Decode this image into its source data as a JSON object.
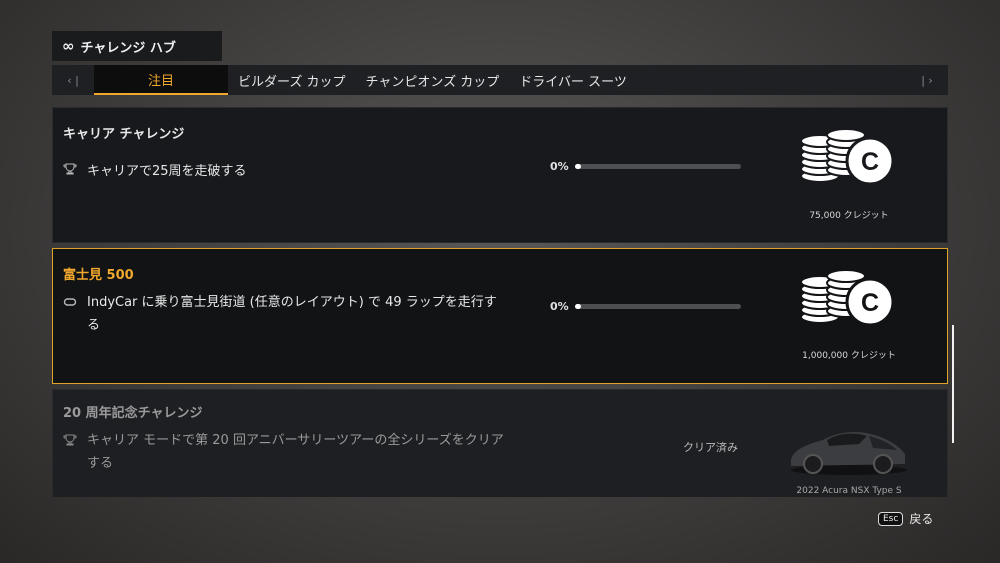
{
  "header": {
    "title_icon": "infinity-icon",
    "title": "チャレンジ ハブ"
  },
  "tabs": {
    "prev_label": "‹ |",
    "next_label": "| ›",
    "items": [
      {
        "label": "注目",
        "active": true
      },
      {
        "label": "ビルダーズ カップ"
      },
      {
        "label": "チャンピオンズ カップ"
      },
      {
        "label": "ドライバー スーツ"
      }
    ]
  },
  "challenges": [
    {
      "title": "キャリア チャレンジ",
      "task_icon": "trophy-icon",
      "task": "キャリアで25周を走破する",
      "progress_label": "0%",
      "progress": 0,
      "reward_icon": "credits-icon",
      "reward_label": "75,000 クレジット"
    },
    {
      "title": "富士見 500",
      "task_icon": "track-icon",
      "task_line1": "IndyCar に乗り富士見街道 (任意のレイアウト) で 49 ラップを走行す",
      "task_line2": "る",
      "progress_label": "0%",
      "progress": 0,
      "reward_icon": "credits-icon",
      "reward_label": "1,000,000 クレジット"
    },
    {
      "title": "20 周年記念チャレンジ",
      "task_icon": "trophy-icon",
      "task_line1": "キャリア モードで第 20 回アニバーサリーツアーの全シリーズをクリア",
      "task_line2": "する",
      "status": "クリア済み",
      "reward_icon": "car-icon",
      "reward_label": "2022 Acura NSX Type S"
    }
  ],
  "footer": {
    "key": "Esc",
    "label": "戻る"
  },
  "colors": {
    "accent": "#f0a82d",
    "card": "#17191c",
    "highlight_border": "#e0a22c"
  }
}
